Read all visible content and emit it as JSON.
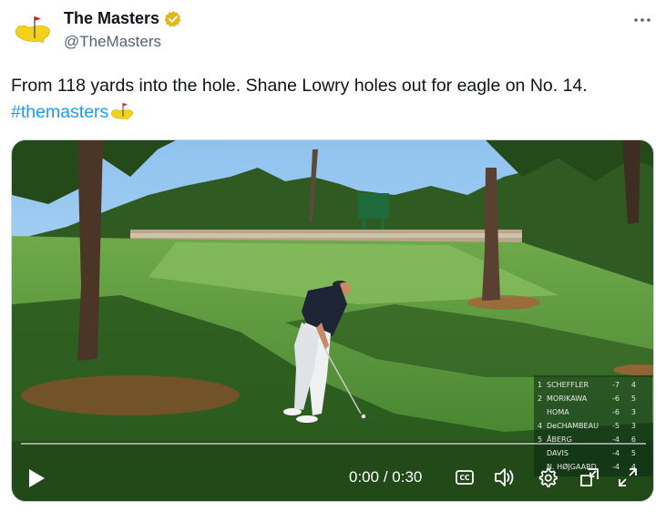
{
  "account": {
    "display_name": "The Masters",
    "handle": "@TheMasters",
    "verified": true,
    "avatar_icon": "masters-logo-icon"
  },
  "tweet": {
    "text": "From 118 yards into the hole. Shane Lowry holes out for eagle on No. 14.",
    "hashtag": "#themasters",
    "hashtag_emoji": "masters-flag-emoji"
  },
  "video": {
    "current_time": "0:00",
    "separator": "/",
    "duration": "0:30",
    "progress": 0.0,
    "controls": {
      "play_icon": "play-icon",
      "captions_label": "CC",
      "volume_icon": "volume-icon",
      "settings_icon": "gear-icon",
      "pip_icon": "picture-in-picture-icon",
      "fullscreen_icon": "fullscreen-icon"
    }
  },
  "leaderboard": {
    "rows": [
      {
        "pos": "1",
        "name": "SCHEFFLER",
        "score": "-7",
        "thru": "4"
      },
      {
        "pos": "2",
        "name": "MORIKAWA",
        "score": "-6",
        "thru": "5"
      },
      {
        "pos": "",
        "name": "HOMA",
        "score": "-6",
        "thru": "3"
      },
      {
        "pos": "4",
        "name": "DeCHAMBEAU",
        "score": "-5",
        "thru": "3"
      },
      {
        "pos": "5",
        "name": "ÅBERG",
        "score": "-4",
        "thru": "6"
      },
      {
        "pos": "",
        "name": "DAVIS",
        "score": "-4",
        "thru": "5"
      },
      {
        "pos": "",
        "name": "N. HØJGAARD",
        "score": "-4",
        "thru": "4"
      }
    ]
  },
  "colors": {
    "hashtag": "#1d9bf0",
    "verified_badge": "#e2b719",
    "text_primary": "#0f1419",
    "text_secondary": "#536471"
  }
}
